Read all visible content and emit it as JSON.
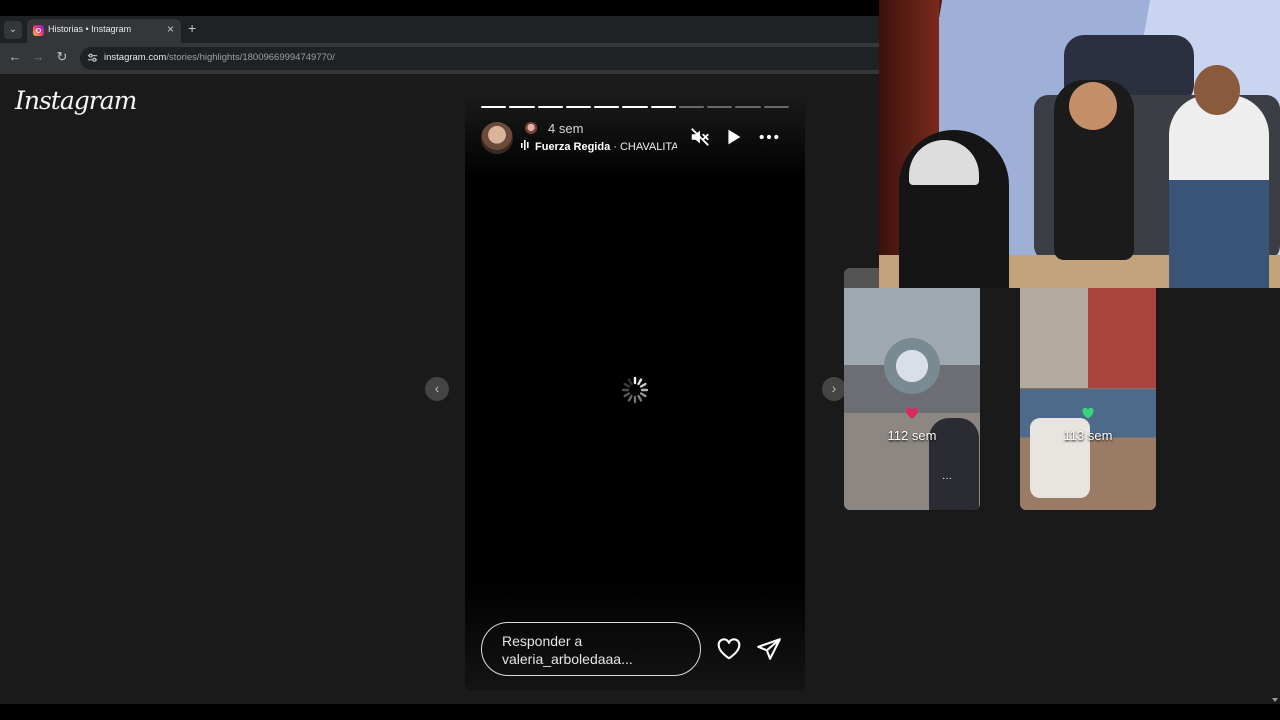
{
  "browser": {
    "tab": {
      "title": "Historias • Instagram",
      "close_glyph": "×"
    },
    "tab_search_glyph": "⌄",
    "new_tab_glyph": "+",
    "nav": {
      "back_glyph": "←",
      "forward_glyph": "→",
      "reload_glyph": "↻"
    },
    "url_host": "instagram.com",
    "url_path": "/stories/highlights/18009669994749770/"
  },
  "instagram": {
    "logo_text": "Instagram",
    "story": {
      "segments_total": 11,
      "segments_viewed": 7,
      "time_ago": "4 sem",
      "music_artist": "Fuerza Regida",
      "music_title": " · CHAVALITA",
      "reply_placeholder_line1": "Responder a",
      "reply_placeholder_line2": "valeria_arboledaaa...",
      "prev_glyph": "‹",
      "next_glyph": "›"
    },
    "previews": [
      {
        "time_ago": "112 sem",
        "heart_color": "#e0245e",
        "dots": "···"
      },
      {
        "time_ago": "113 sem",
        "heart_color": "#37d67a"
      }
    ]
  },
  "colors": {
    "page_bg": "#1a1a1a",
    "story_bg": "#000000",
    "chrome_dark": "#202124",
    "chrome_light": "#35363a"
  }
}
